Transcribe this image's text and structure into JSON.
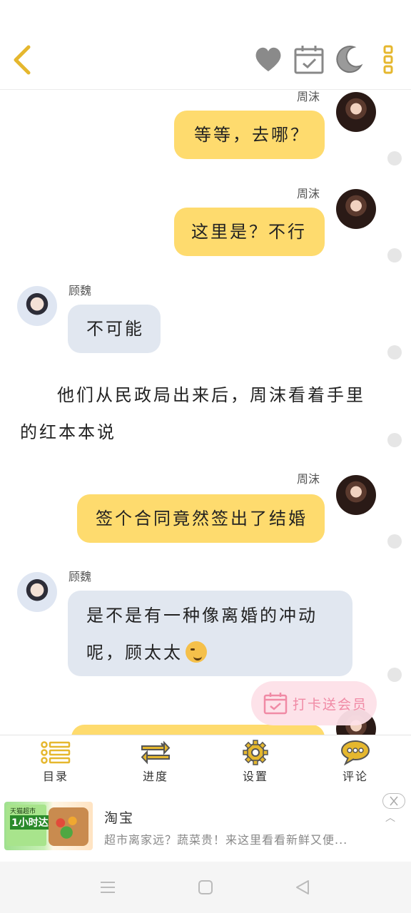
{
  "header": {
    "back_icon": "chevron-left-icon",
    "favorite_icon": "heart-icon",
    "checkin_icon": "calendar-check-icon",
    "night_mode_icon": "moon-icon",
    "more_icon": "more-vertical-icon",
    "accent_color": "#e5b72e"
  },
  "chat": {
    "messages": [
      {
        "speaker": "周沫",
        "side": "right",
        "text": "等等，去哪？"
      },
      {
        "speaker": "周沫",
        "side": "right",
        "text": "这里是？不行"
      },
      {
        "speaker": "顾魏",
        "side": "left",
        "text": "不可能"
      },
      {
        "narration": "他们从民政局出来后，周沫看着手里的红本本说"
      },
      {
        "speaker": "周沫",
        "side": "right",
        "text": "签个合同竟然签出了结婚"
      },
      {
        "speaker": "顾魏",
        "side": "left",
        "text": "是不是有一种像离婚的冲动呢，顾太太",
        "emoji": "smirk-emoji"
      }
    ],
    "colors": {
      "self_bubble": "#fedb6e",
      "other_bubble": "#e1e7f0"
    }
  },
  "checkin_button": {
    "label": "打卡送会员",
    "icon": "calendar-check-icon"
  },
  "bottom_nav": {
    "items": [
      {
        "label": "目录",
        "icon": "list-icon"
      },
      {
        "label": "进度",
        "icon": "swap-arrows-icon"
      },
      {
        "label": "设置",
        "icon": "gear-icon"
      },
      {
        "label": "评论",
        "icon": "chat-bubble-icon"
      }
    ]
  },
  "ad": {
    "title": "淘宝",
    "description": "超市离家远？蔬菜贵！来这里看看新鲜又便...",
    "image_text_1": "天猫超市",
    "image_text_2": "1小时达"
  },
  "system_nav": {
    "icons": [
      "menu-icon",
      "home-square-icon",
      "back-triangle-icon"
    ]
  }
}
